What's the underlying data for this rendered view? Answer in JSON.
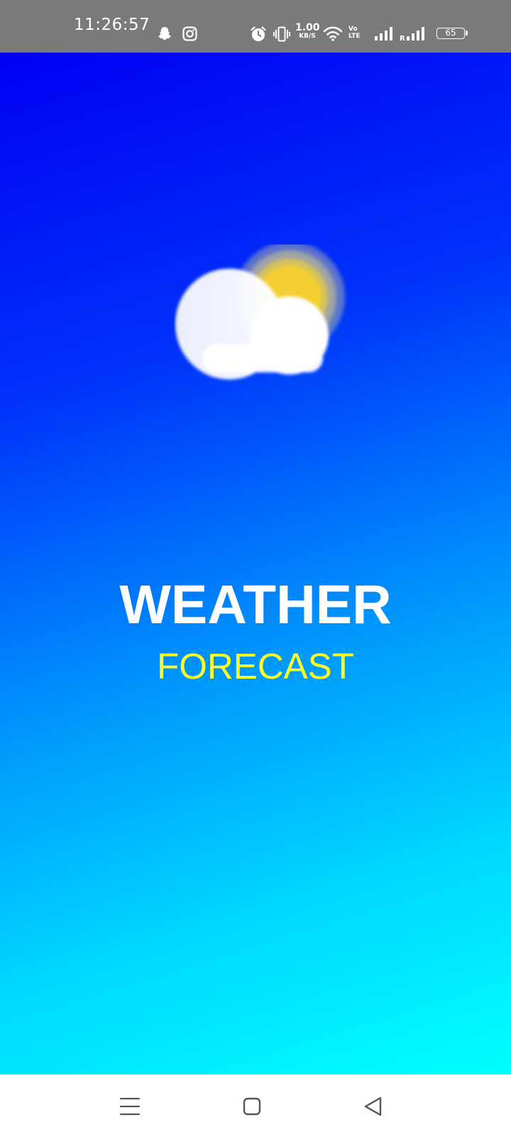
{
  "status_bar": {
    "time": "11:26:57",
    "net_speed_value": "1.00",
    "net_speed_unit": "KB/S",
    "volte_top": "Vo",
    "volte_bottom": "LTE",
    "roaming_indicator": "R",
    "battery_level": "65",
    "icons": [
      "snapchat-icon",
      "instagram-icon",
      "alarm-icon",
      "vibrate-icon",
      "wifi-icon",
      "signal-icon",
      "signal-roaming-icon",
      "battery-icon"
    ]
  },
  "splash": {
    "logo_icon": "partly-cloudy-icon",
    "title": "WEATHER",
    "subtitle": "FORECAST",
    "gradient_start": "#0000f5",
    "gradient_end": "#00ffff",
    "title_color": "#ffffff",
    "subtitle_color": "#ffff22"
  },
  "nav_bar": {
    "buttons": [
      "menu-icon",
      "home-icon",
      "back-icon"
    ]
  }
}
